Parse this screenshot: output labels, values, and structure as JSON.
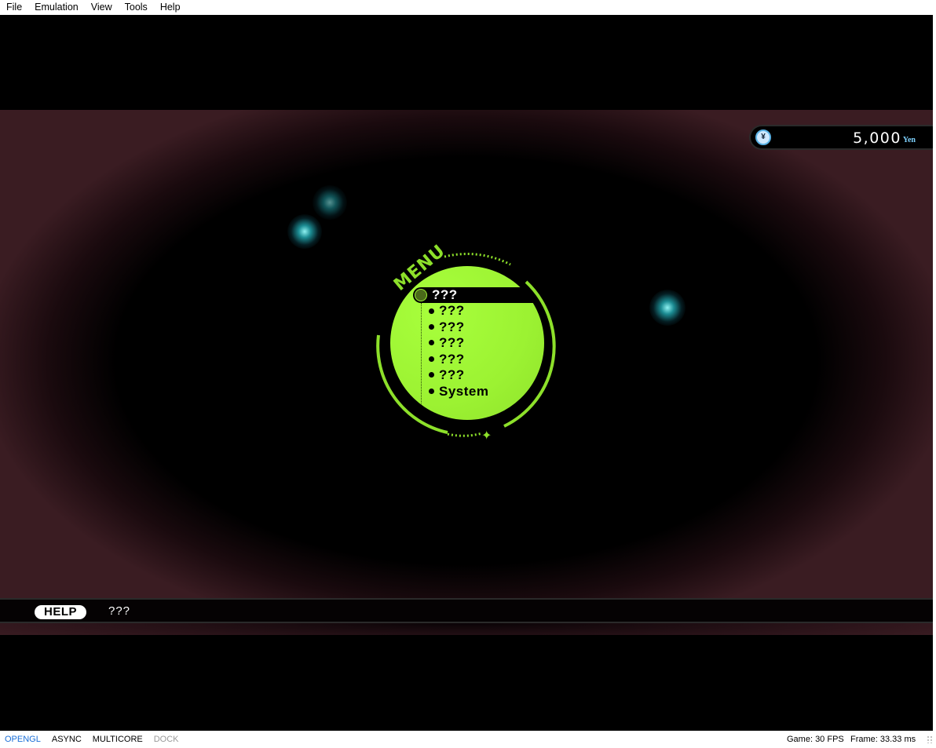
{
  "menubar": {
    "items": [
      {
        "label": "File"
      },
      {
        "label": "Emulation"
      },
      {
        "label": "View"
      },
      {
        "label": "Tools"
      },
      {
        "label": "Help"
      }
    ]
  },
  "hud": {
    "money_amount": "5,000",
    "money_unit": "Yen",
    "money_icon": "yen-coin-icon"
  },
  "game_menu": {
    "title": "MENU",
    "items": [
      {
        "label": "???",
        "selected": true
      },
      {
        "label": "???"
      },
      {
        "label": "???"
      },
      {
        "label": "???"
      },
      {
        "label": "???"
      },
      {
        "label": "???"
      },
      {
        "label": "System"
      }
    ],
    "accent_color": "#9cf232"
  },
  "help_bar": {
    "badge": "HELP",
    "text": "???"
  },
  "statusbar": {
    "renderer": "OPENGL",
    "async": "ASYNC",
    "multicore": "MULTICORE",
    "dock": "DOCK",
    "game_fps": "Game: 30 FPS",
    "frame_time": "Frame: 33.33 ms"
  },
  "colors": {
    "scene_edge": "#3a1c22",
    "glow": "#28c8d2",
    "statusbar_active": "#1a6fd8"
  }
}
